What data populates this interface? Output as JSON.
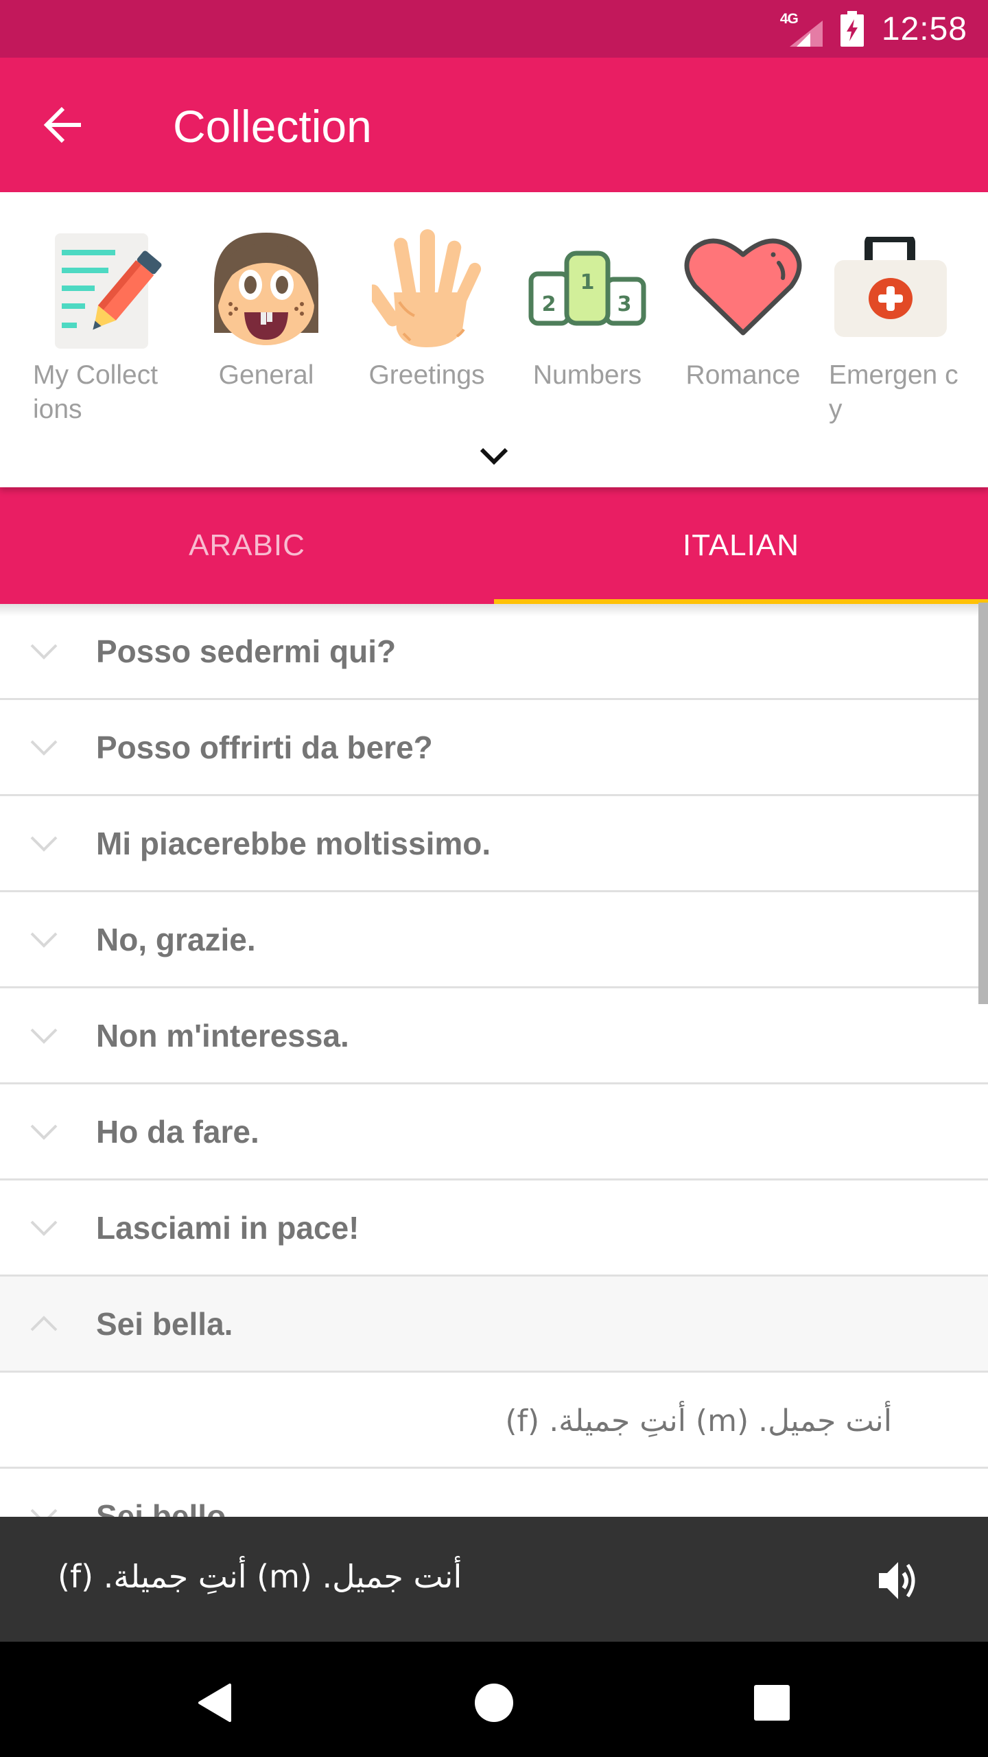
{
  "status_bar": {
    "network": "4G",
    "time": "12:58",
    "icons": [
      "signal-icon",
      "battery-charging-icon"
    ]
  },
  "app_bar": {
    "title": "Collection",
    "back_icon": "arrow-back-icon"
  },
  "categories": [
    {
      "label": "My Collections",
      "label_wrapped": "My Collect ions",
      "icon": "notepad-pencil-icon"
    },
    {
      "label": "General",
      "icon": "girl-face-icon"
    },
    {
      "label": "Greetings",
      "icon": "waving-hand-icon"
    },
    {
      "label": "Numbers",
      "icon": "podium-icon"
    },
    {
      "label": "Romance",
      "icon": "heart-icon"
    },
    {
      "label": "Emergency",
      "label_wrapped": "Emergen cy",
      "icon": "first-aid-kit-icon"
    }
  ],
  "expand_icon": "chevron-down-icon",
  "tabs": [
    {
      "label": "ARABIC",
      "active": false
    },
    {
      "label": "ITALIAN",
      "active": true
    }
  ],
  "phrases": [
    {
      "text": "Posso sedermi qui?",
      "expanded": false
    },
    {
      "text": "Posso offrirti da bere?",
      "expanded": false
    },
    {
      "text": "Mi piacerebbe moltissimo.",
      "expanded": false
    },
    {
      "text": "No, grazie.",
      "expanded": false
    },
    {
      "text": "Non m'interessa.",
      "expanded": false
    },
    {
      "text": "Ho da fare.",
      "expanded": false
    },
    {
      "text": "Lasciami in pace!",
      "expanded": false
    },
    {
      "text": "Sei bella.",
      "expanded": true,
      "translation": "أنت جميل. (m)  أنتِ جميلة. (f)"
    },
    {
      "text": "Sei bello.",
      "expanded": false
    }
  ],
  "player": {
    "text": "أنت جميل. (m)  أنتِ جميلة. (f)",
    "icon": "speaker-icon"
  },
  "colors": {
    "status_bar": "#c2185b",
    "primary": "#e91e63",
    "tab_indicator": "#ffc107",
    "player_bg": "#333333"
  }
}
